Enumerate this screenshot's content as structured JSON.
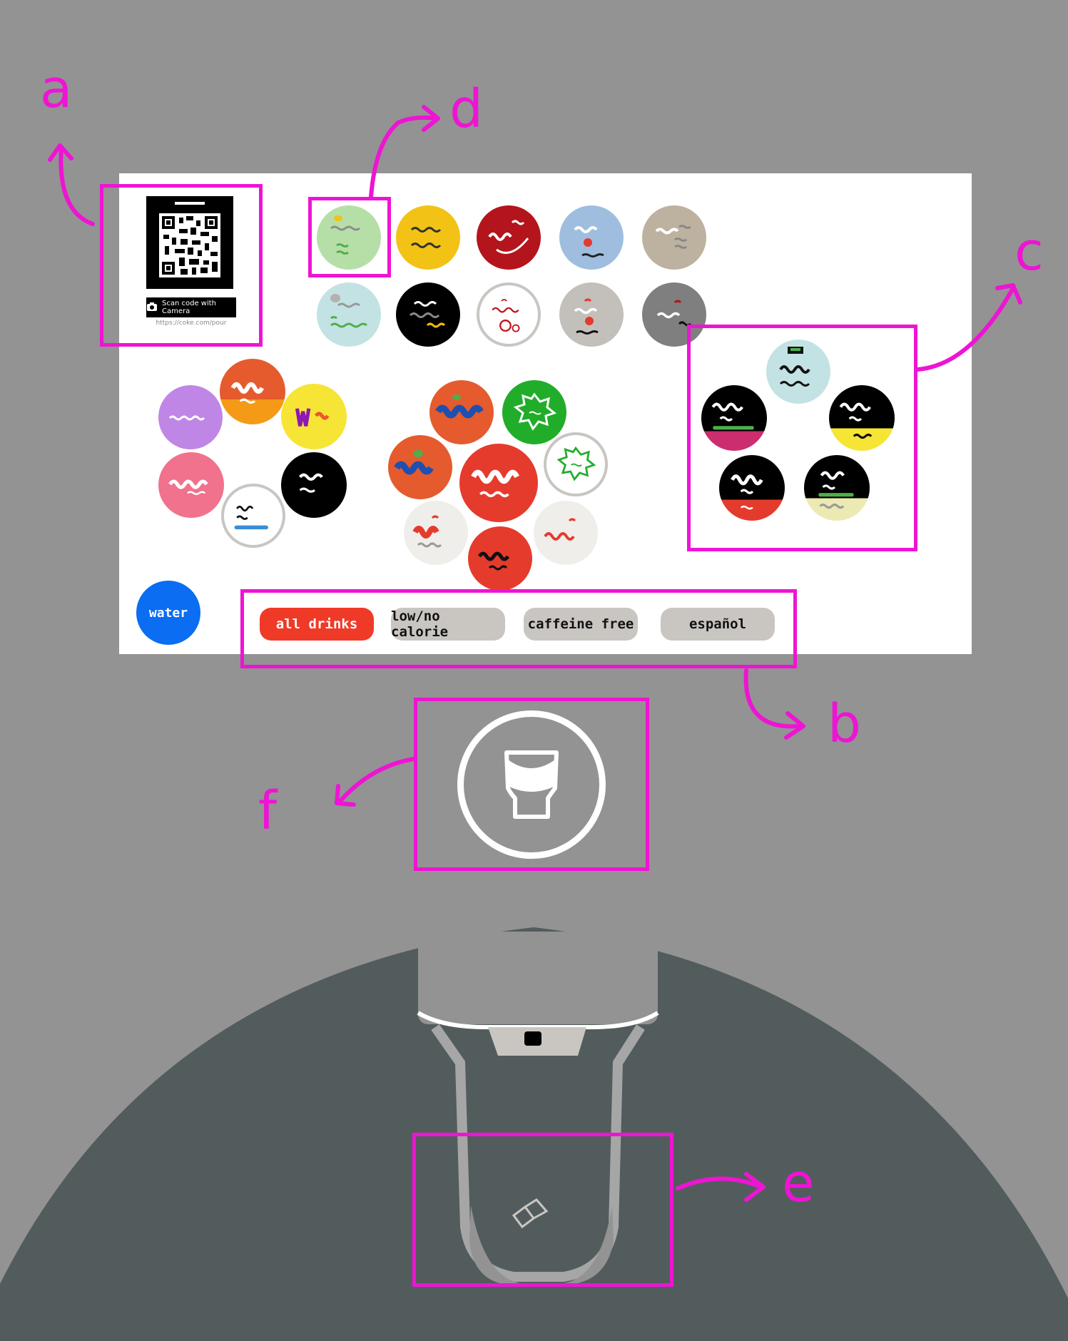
{
  "qr": {
    "scan_label": "Scan code with Camera",
    "url": "https://coke.com/pour"
  },
  "water": {
    "label": "water"
  },
  "filters": [
    {
      "label": "all drinks",
      "selected": true,
      "color": "#f03a28"
    },
    {
      "label": "low/no calorie",
      "selected": false,
      "color": "#c9c6c2"
    },
    {
      "label": "caffeine free",
      "selected": false,
      "color": "#c9c6c2"
    },
    {
      "label": "español",
      "selected": false,
      "color": "#c9c6c2"
    }
  ],
  "callouts": {
    "a": "a",
    "b": "b",
    "c": "c",
    "d": "d",
    "e": "e",
    "f": "f"
  },
  "colors": {
    "background": "#939393",
    "screen": "#ffffff",
    "highlight": "#ee14d4",
    "water": "#0a6df2",
    "dispenser_body": "#535c5d",
    "selected_filter": "#f03a28"
  },
  "drink_grid_row1": [
    "#b6dfa8",
    "#f2c315",
    "#b4141b",
    "#9fbedf",
    "#bdb1a0"
  ],
  "drink_grid_row2": [
    "#c3e2e4",
    "#000000",
    "#ffffff",
    "#c3bfba",
    "#7f7f7f"
  ],
  "cluster_icons": {
    "pour_button": "cup-icon",
    "ice": "ice-cube-icon",
    "camera": "camera-icon"
  }
}
